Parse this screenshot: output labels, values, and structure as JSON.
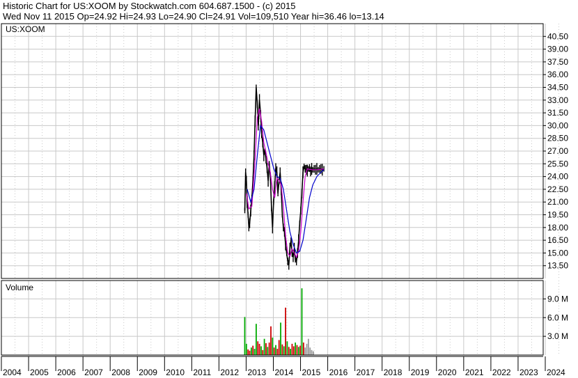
{
  "header": {
    "line1": "Historic Chart for US:XOOM by Stockwatch.com 604.687.1500 - (c) 2015",
    "line2": "Wed Nov 11 2015   Op=24.92   Hi=24.93   Lo=24.90   Cl=24.91   Vol=109,510   Year hi=36.46   lo=13.14"
  },
  "colors": {
    "price": "#000000",
    "ma_short": "#cc00cc",
    "ma_long": "#0000cc",
    "volume_up": "#00aa00",
    "volume_down": "#cc0000",
    "volume_flat": "#999999",
    "grid": "#c8c8c8"
  },
  "chart_data": [
    {
      "type": "line",
      "title": "US:XOOM",
      "ylim": [
        12.0,
        42.0
      ],
      "y_ticks": [
        "13.50",
        "15.00",
        "16.50",
        "18.00",
        "19.50",
        "21.00",
        "22.50",
        "24.00",
        "25.50",
        "27.00",
        "28.50",
        "30.00",
        "31.50",
        "33.00",
        "34.50",
        "36.00",
        "37.50",
        "39.00",
        "40.50"
      ],
      "x_ticks": [
        "2004",
        "2005",
        "2006",
        "2007",
        "2008",
        "2009",
        "2010",
        "2011",
        "2012",
        "2013",
        "2014",
        "2015",
        "2016",
        "2017",
        "2018",
        "2019",
        "2020",
        "2021",
        "2022",
        "2023",
        "2024"
      ],
      "grid": true,
      "series": [
        {
          "kind": "price",
          "x": [
            2012.95,
            2012.98,
            2013.01,
            2013.04,
            2013.07,
            2013.1,
            2013.13,
            2013.17,
            2013.21,
            2013.25,
            2013.29,
            2013.33,
            2013.37,
            2013.41,
            2013.45,
            2013.49,
            2013.53,
            2013.57,
            2013.61,
            2013.65,
            2013.69,
            2013.73,
            2013.77,
            2013.81,
            2013.85,
            2013.89,
            2013.93,
            2013.97,
            2014.01,
            2014.05,
            2014.09,
            2014.13,
            2014.17,
            2014.21,
            2014.25,
            2014.29,
            2014.33,
            2014.37,
            2014.41,
            2014.45,
            2014.49,
            2014.53,
            2014.57,
            2014.61,
            2014.65,
            2014.69,
            2014.73,
            2014.77,
            2014.81,
            2014.85,
            2014.89,
            2014.93,
            2014.97,
            2015.01,
            2015.05,
            2015.09,
            2015.13,
            2015.17,
            2015.21,
            2015.25,
            2015.29,
            2015.33,
            2015.37,
            2015.41,
            2015.45,
            2015.5,
            2015.55,
            2015.6,
            2015.65,
            2015.7,
            2015.75,
            2015.8,
            2015.86
          ],
          "y": [
            20.0,
            24.5,
            23.5,
            21.0,
            19.5,
            18.0,
            18.5,
            20.0,
            21.5,
            23.5,
            26.5,
            30.5,
            34.5,
            32.5,
            30.0,
            33.0,
            31.5,
            29.0,
            28.0,
            26.5,
            27.0,
            26.0,
            25.0,
            23.5,
            25.5,
            24.0,
            20.5,
            18.0,
            21.0,
            23.0,
            25.0,
            24.5,
            22.0,
            23.5,
            24.5,
            22.5,
            19.5,
            18.0,
            17.5,
            16.0,
            15.0,
            14.0,
            13.6,
            15.5,
            16.5,
            15.0,
            14.5,
            15.5,
            14.2,
            14.0,
            15.0,
            16.5,
            18.5,
            20.0,
            22.0,
            24.5,
            25.2,
            24.9,
            24.8,
            24.7,
            24.9,
            25.0,
            24.6,
            24.9,
            24.8,
            24.9,
            24.8,
            24.9,
            24.8,
            24.9,
            24.9,
            24.8,
            24.91
          ]
        },
        {
          "kind": "ma_short",
          "x": [
            2013.01,
            2013.1,
            2013.21,
            2013.33,
            2013.41,
            2013.49,
            2013.57,
            2013.65,
            2013.73,
            2013.81,
            2013.89,
            2013.97,
            2014.05,
            2014.13,
            2014.21,
            2014.29,
            2014.37,
            2014.45,
            2014.53,
            2014.61,
            2014.69,
            2014.77,
            2014.85,
            2014.93,
            2015.01,
            2015.09,
            2015.17,
            2015.25,
            2015.41,
            2015.6,
            2015.86
          ],
          "y": [
            22.0,
            20.2,
            20.5,
            26.0,
            31.0,
            32.0,
            30.5,
            28.0,
            26.8,
            25.5,
            24.5,
            22.5,
            21.5,
            23.8,
            23.5,
            23.0,
            20.5,
            17.0,
            15.0,
            14.6,
            15.5,
            15.0,
            14.5,
            15.2,
            17.5,
            21.0,
            24.0,
            24.9,
            24.8,
            24.8,
            24.9
          ]
        },
        {
          "kind": "ma_long",
          "x": [
            2013.04,
            2013.17,
            2013.29,
            2013.41,
            2013.53,
            2013.65,
            2013.77,
            2013.89,
            2014.01,
            2014.13,
            2014.25,
            2014.37,
            2014.49,
            2014.61,
            2014.73,
            2014.85,
            2014.97,
            2015.09,
            2015.21,
            2015.33,
            2015.45,
            2015.6,
            2015.75,
            2015.86
          ],
          "y": [
            22.5,
            21.0,
            22.5,
            26.5,
            30.0,
            29.5,
            28.0,
            26.5,
            25.0,
            24.0,
            23.8,
            22.5,
            20.0,
            17.5,
            16.0,
            15.0,
            15.2,
            16.5,
            19.0,
            21.5,
            23.0,
            24.0,
            24.5,
            24.8
          ]
        }
      ]
    },
    {
      "type": "bar",
      "title": "Volume",
      "y_ticks": [
        "3.0 M",
        "6.0 M",
        "9.0 M"
      ],
      "ylim": [
        0,
        11.5
      ],
      "unit": "M",
      "x": [
        2012.95,
        2013.01,
        2013.07,
        2013.13,
        2013.19,
        2013.25,
        2013.31,
        2013.37,
        2013.43,
        2013.49,
        2013.55,
        2013.61,
        2013.67,
        2013.73,
        2013.79,
        2013.85,
        2013.91,
        2013.97,
        2014.03,
        2014.09,
        2014.15,
        2014.21,
        2014.27,
        2014.33,
        2014.39,
        2014.45,
        2014.51,
        2014.57,
        2014.63,
        2014.69,
        2014.75,
        2014.81,
        2014.87,
        2014.93,
        2014.99,
        2015.05,
        2015.11,
        2015.17,
        2015.23,
        2015.29,
        2015.35,
        2015.41,
        2015.47
      ],
      "values": [
        6.1,
        1.8,
        0.9,
        0.7,
        1.2,
        1.5,
        1.0,
        5.0,
        2.2,
        1.8,
        1.4,
        0.8,
        2.6,
        1.9,
        1.3,
        2.0,
        4.6,
        2.8,
        1.2,
        1.6,
        1.0,
        2.4,
        5.2,
        1.7,
        1.4,
        7.6,
        2.2,
        1.3,
        1.0,
        1.8,
        1.4,
        2.0,
        1.6,
        1.3,
        1.5,
        10.7,
        2.0,
        1.2,
        1.8,
        2.6,
        1.2,
        0.8,
        0.6
      ],
      "colors": [
        "up",
        "up",
        "down",
        "down",
        "up",
        "down",
        "up",
        "up",
        "down",
        "down",
        "up",
        "down",
        "up",
        "down",
        "up",
        "down",
        "down",
        "up",
        "down",
        "up",
        "down",
        "down",
        "up",
        "down",
        "up",
        "down",
        "up",
        "down",
        "up",
        "down",
        "down",
        "up",
        "down",
        "up",
        "down",
        "up",
        "down",
        "flat",
        "flat",
        "flat",
        "flat",
        "flat",
        "flat"
      ]
    }
  ]
}
